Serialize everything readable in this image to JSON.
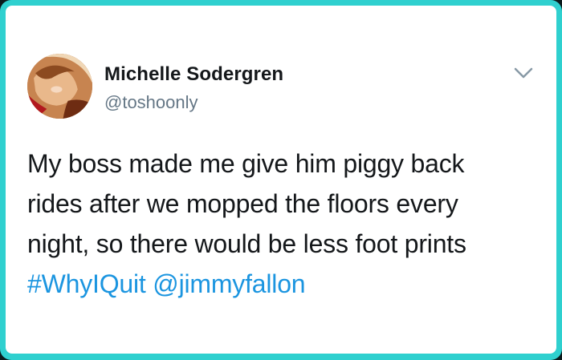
{
  "tweet": {
    "author": {
      "name": "Michelle Sodergren",
      "handle": "@toshoonly"
    },
    "text_lines": [
      "My boss made me give him piggy back",
      "rides after we mopped the floors every",
      "night, so there would be less foot prints"
    ],
    "hashtag": "#WhyIQuit",
    "mention": "@jimmyfallon"
  },
  "colors": {
    "frame_border": "#2fd0cf",
    "link": "#1b95e0",
    "text": "#14171a",
    "muted": "#657786"
  },
  "icons": {
    "menu": "chevron-down-icon"
  }
}
